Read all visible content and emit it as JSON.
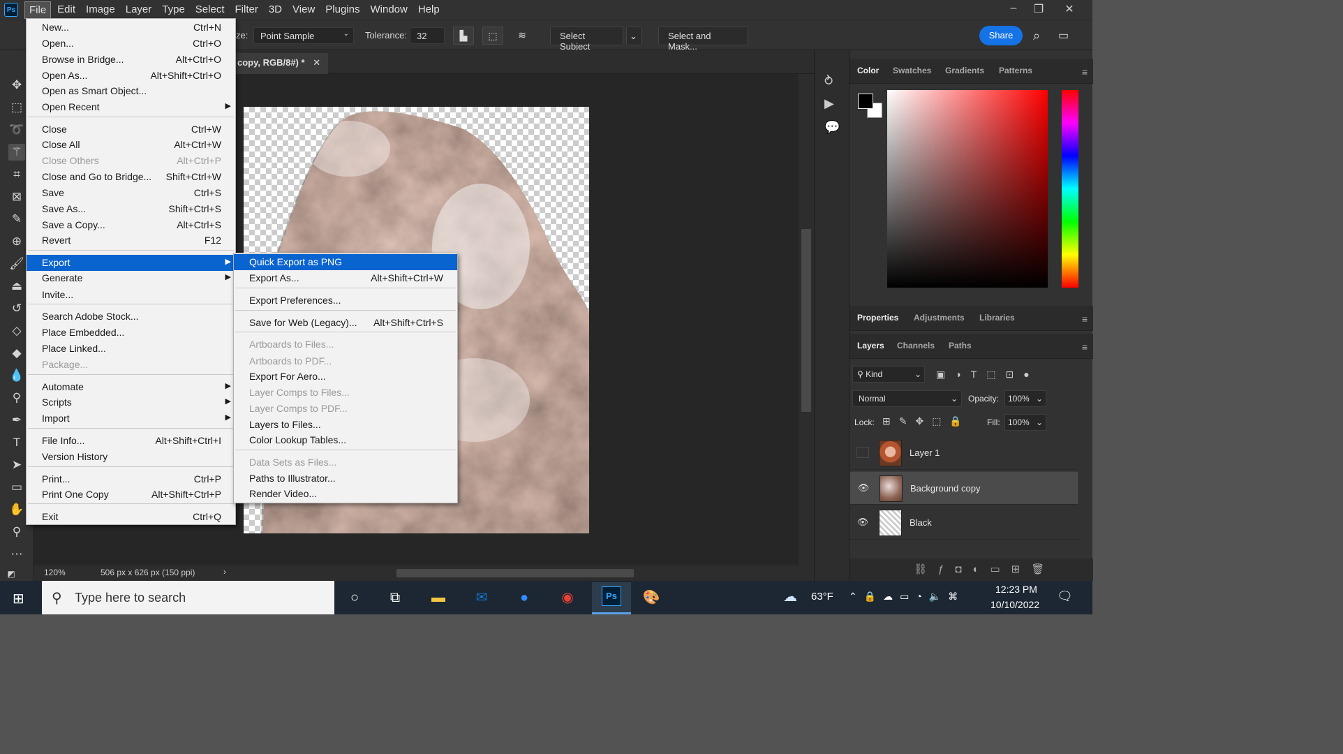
{
  "app": {
    "logo": "Ps"
  },
  "menubar": {
    "items": [
      "File",
      "Edit",
      "Image",
      "Layer",
      "Type",
      "Select",
      "Filter",
      "3D",
      "View",
      "Plugins",
      "Window",
      "Help"
    ],
    "active": "File"
  },
  "options": {
    "sample_size_label": "ze:",
    "sample_size_value": "Point Sample",
    "tolerance_label": "Tolerance:",
    "tolerance_value": "32",
    "select_subject": "Select Subject",
    "select_mask": "Select and Mask...",
    "share": "Share"
  },
  "document": {
    "tab_title": "copy, RGB/8#) *",
    "zoom": "120%",
    "dimensions": "506 px x 626 px (150 ppi)"
  },
  "file_menu": [
    {
      "label": "New...",
      "shortcut": "Ctrl+N"
    },
    {
      "label": "Open...",
      "shortcut": "Ctrl+O"
    },
    {
      "label": "Browse in Bridge...",
      "shortcut": "Alt+Ctrl+O"
    },
    {
      "label": "Open As...",
      "shortcut": "Alt+Shift+Ctrl+O"
    },
    {
      "label": "Open as Smart Object...",
      "shortcut": ""
    },
    {
      "label": "Open Recent",
      "shortcut": "",
      "submenu": true
    },
    {
      "label": "Close",
      "shortcut": "Ctrl+W"
    },
    {
      "label": "Close All",
      "shortcut": "Alt+Ctrl+W"
    },
    {
      "label": "Close Others",
      "shortcut": "Alt+Ctrl+P",
      "disabled": true
    },
    {
      "label": "Close and Go to Bridge...",
      "shortcut": "Shift+Ctrl+W"
    },
    {
      "label": "Save",
      "shortcut": "Ctrl+S"
    },
    {
      "label": "Save As...",
      "shortcut": "Shift+Ctrl+S"
    },
    {
      "label": "Save a Copy...",
      "shortcut": "Alt+Ctrl+S"
    },
    {
      "label": "Revert",
      "shortcut": "F12"
    },
    {
      "label": "Export",
      "shortcut": "",
      "submenu": true,
      "highlighted": true
    },
    {
      "label": "Generate",
      "shortcut": "",
      "submenu": true
    },
    {
      "label": "Invite...",
      "shortcut": ""
    },
    {
      "label": "Search Adobe Stock...",
      "shortcut": ""
    },
    {
      "label": "Place Embedded...",
      "shortcut": ""
    },
    {
      "label": "Place Linked...",
      "shortcut": ""
    },
    {
      "label": "Package...",
      "shortcut": "",
      "disabled": true
    },
    {
      "label": "Automate",
      "shortcut": "",
      "submenu": true
    },
    {
      "label": "Scripts",
      "shortcut": "",
      "submenu": true
    },
    {
      "label": "Import",
      "shortcut": "",
      "submenu": true
    },
    {
      "label": "File Info...",
      "shortcut": "Alt+Shift+Ctrl+I"
    },
    {
      "label": "Version History",
      "shortcut": ""
    },
    {
      "label": "Print...",
      "shortcut": "Ctrl+P"
    },
    {
      "label": "Print One Copy",
      "shortcut": "Alt+Shift+Ctrl+P"
    },
    {
      "label": "Exit",
      "shortcut": "Ctrl+Q"
    }
  ],
  "export_menu": [
    {
      "label": "Quick Export as PNG",
      "shortcut": "",
      "highlighted": true
    },
    {
      "label": "Export As...",
      "shortcut": "Alt+Shift+Ctrl+W"
    },
    {
      "label": "Export Preferences...",
      "shortcut": ""
    },
    {
      "label": "Save for Web (Legacy)...",
      "shortcut": "Alt+Shift+Ctrl+S"
    },
    {
      "label": "Artboards to Files...",
      "shortcut": "",
      "disabled": true
    },
    {
      "label": "Artboards to PDF...",
      "shortcut": "",
      "disabled": true
    },
    {
      "label": "Export For Aero...",
      "shortcut": ""
    },
    {
      "label": "Layer Comps to Files...",
      "shortcut": "",
      "disabled": true
    },
    {
      "label": "Layer Comps to PDF...",
      "shortcut": "",
      "disabled": true
    },
    {
      "label": "Layers to Files...",
      "shortcut": ""
    },
    {
      "label": "Color Lookup Tables...",
      "shortcut": ""
    },
    {
      "label": "Data Sets as Files...",
      "shortcut": "",
      "disabled": true
    },
    {
      "label": "Paths to Illustrator...",
      "shortcut": ""
    },
    {
      "label": "Render Video...",
      "shortcut": ""
    }
  ],
  "panels": {
    "color_tabs": [
      "Color",
      "Swatches",
      "Gradients",
      "Patterns"
    ],
    "props_tabs": [
      "Properties",
      "Adjustments",
      "Libraries"
    ],
    "layers_tabs": [
      "Layers",
      "Channels",
      "Paths"
    ],
    "filter_kind": "Kind",
    "blend_mode": "Normal",
    "opacity_label": "Opacity:",
    "opacity_value": "100%",
    "lock_label": "Lock:",
    "fill_label": "Fill:",
    "fill_value": "100%"
  },
  "layers": [
    {
      "name": "Layer 1",
      "visible": false,
      "selected": false
    },
    {
      "name": "Background copy",
      "visible": true,
      "selected": true
    },
    {
      "name": "Black",
      "visible": true,
      "selected": false
    }
  ],
  "taskbar": {
    "search_placeholder": "Type here to search",
    "temperature": "63°F",
    "time": "12:23 PM",
    "date": "10/10/2022"
  },
  "colors": {
    "accent": "#1473e6",
    "menu_highlight": "#0a64d0"
  }
}
